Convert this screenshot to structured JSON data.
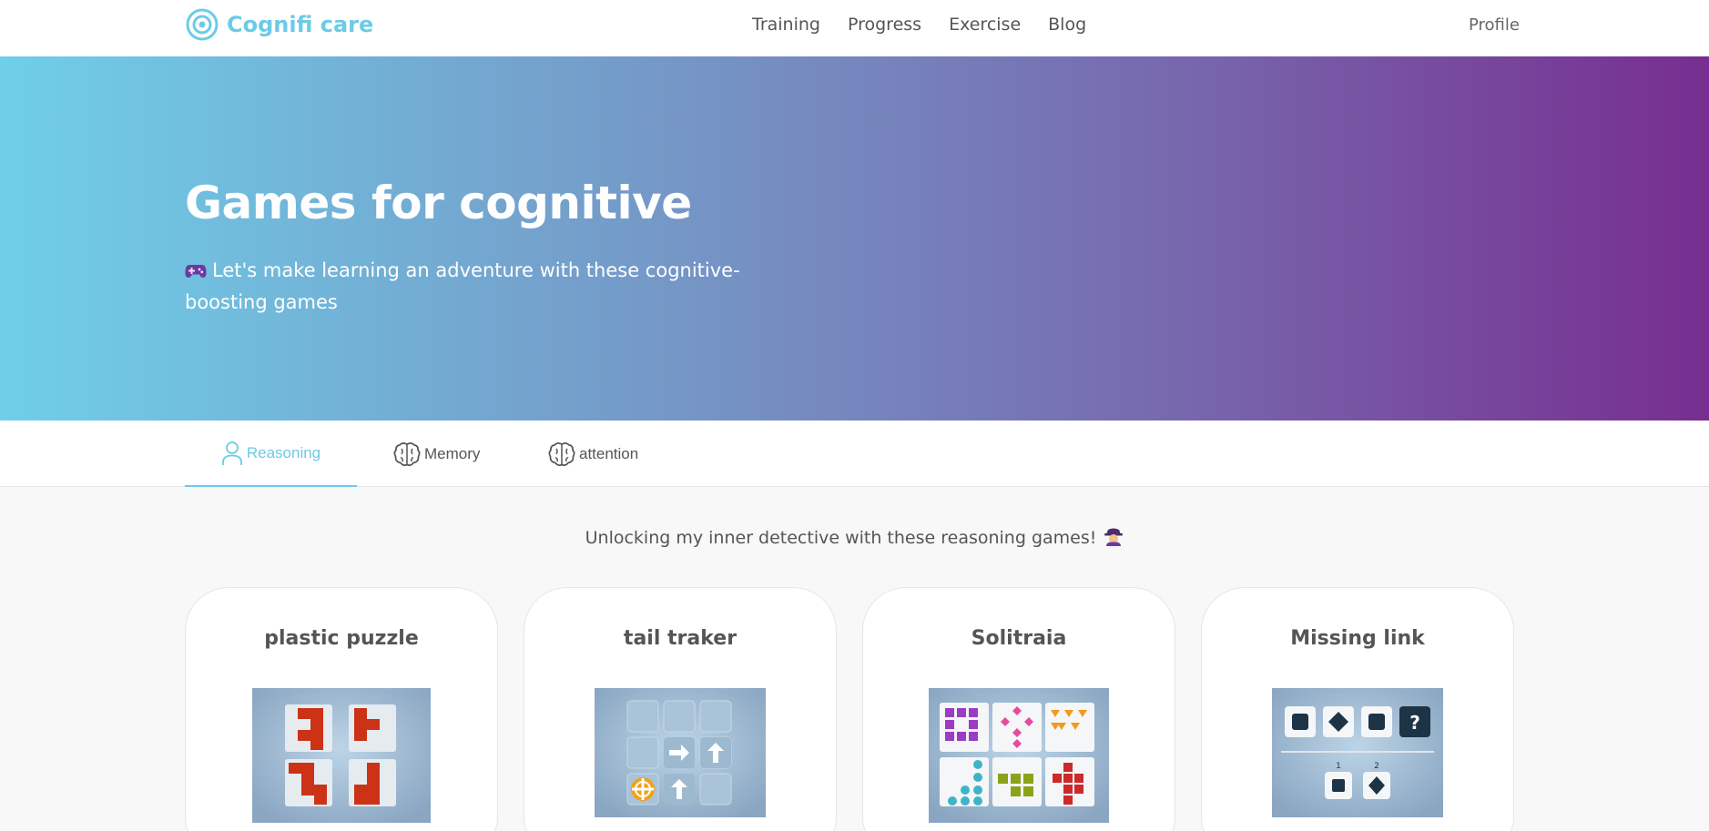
{
  "nav": {
    "brand": "Cognifi care",
    "links": [
      "Training",
      "Progress",
      "Exercise",
      "Blog"
    ],
    "profile": "Profile"
  },
  "hero": {
    "title": "Games for cognitive",
    "subtitle": "Let's make learning an adventure with these cognitive-boosting games"
  },
  "tabs": [
    {
      "label": "Reasoning",
      "icon": "person-icon",
      "active": true
    },
    {
      "label": "Memory",
      "icon": "brain-icon",
      "active": false
    },
    {
      "label": "attention",
      "icon": "brain-icon",
      "active": false
    }
  ],
  "section": {
    "subtitle": "Unlocking my inner detective with these reasoning games!"
  },
  "games": [
    {
      "title": "plastic puzzle"
    },
    {
      "title": "tail traker"
    },
    {
      "title": "Solitraia"
    },
    {
      "title": "Missing link"
    }
  ],
  "colors": {
    "accent": "#6ccbe6",
    "hero_start": "#6fcfe8",
    "hero_end": "#772e90",
    "tile_dark": "#1d3346",
    "puzzle_red": "#cc3316"
  }
}
